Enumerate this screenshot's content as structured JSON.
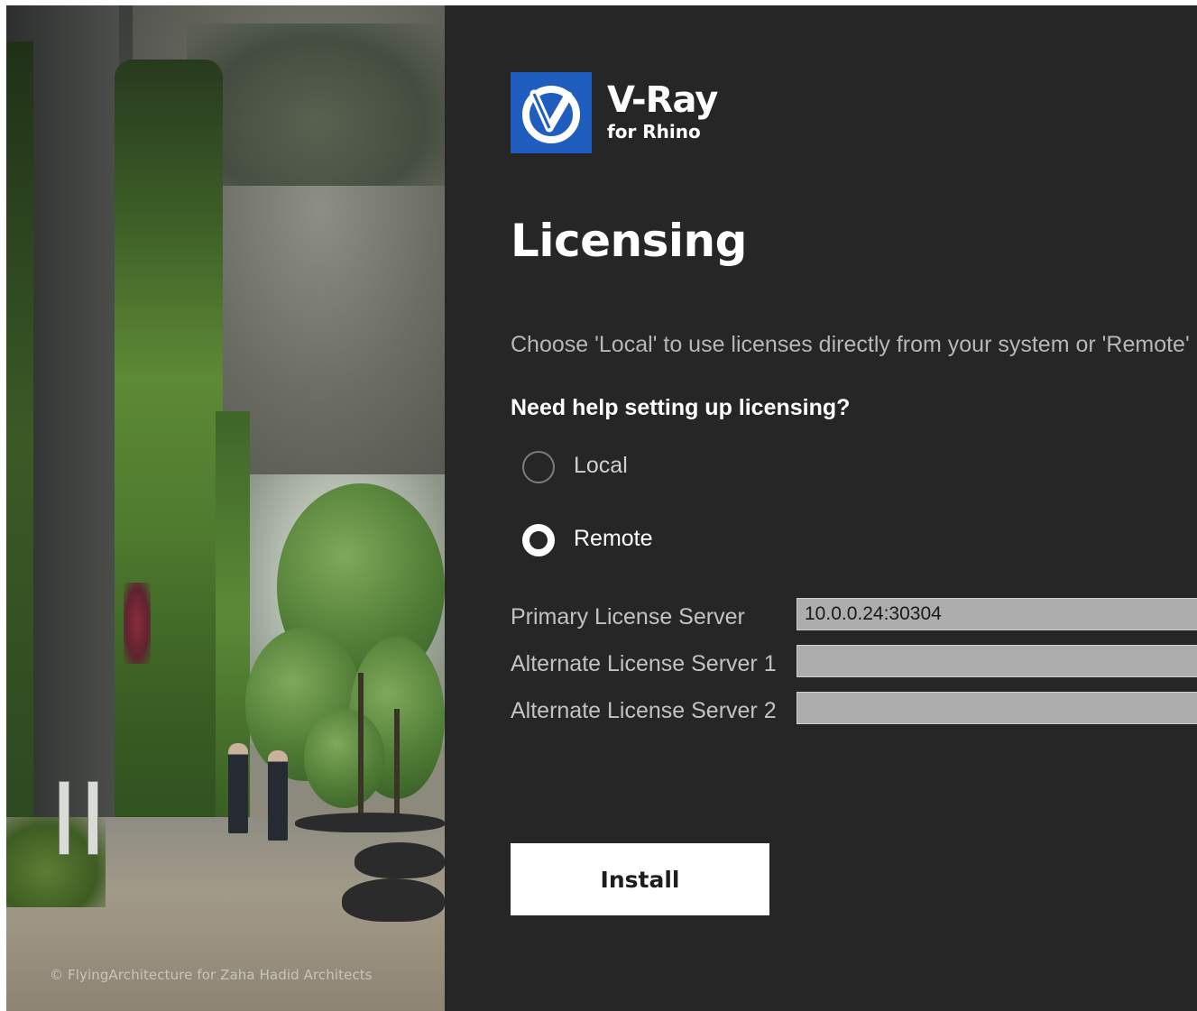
{
  "sidebar": {
    "photo_credit": "© FlyingArchitecture for Zaha Hadid Architects"
  },
  "brand": {
    "logo_icon": "vray-logo-icon",
    "name": "V-Ray",
    "subtitle": "for Rhino",
    "accent_color": "#1f5dbf"
  },
  "main": {
    "title": "Licensing",
    "description": "Choose 'Local' to use licenses directly from your system or 'Remote'",
    "help_link": "Need help setting up licensing?",
    "license_mode": {
      "options": [
        {
          "label": "Local",
          "selected": false
        },
        {
          "label": "Remote",
          "selected": true
        }
      ]
    },
    "servers": {
      "primary_label": "Primary License Server",
      "primary_value": "10.0.0.24:30304",
      "alt1_label": "Alternate License Server 1",
      "alt1_value": "",
      "alt2_label": "Alternate License Server 2",
      "alt2_value": ""
    },
    "install_label": "Install"
  },
  "colors": {
    "background": "#262626",
    "input_background": "#adadad",
    "button_background": "#ffffff"
  }
}
